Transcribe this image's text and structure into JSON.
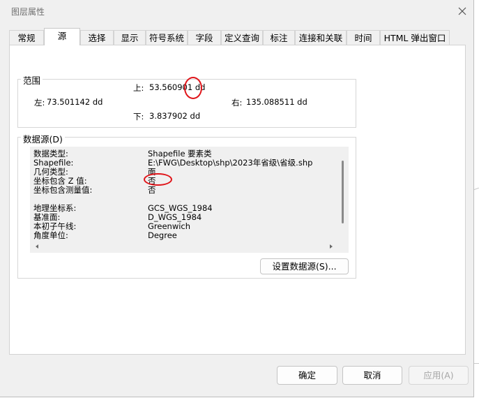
{
  "window": {
    "title": "图层属性"
  },
  "tabs": [
    {
      "label": "常规"
    },
    {
      "label": "源"
    },
    {
      "label": "选择"
    },
    {
      "label": "显示"
    },
    {
      "label": "符号系统"
    },
    {
      "label": "字段"
    },
    {
      "label": "定义查询"
    },
    {
      "label": "标注"
    },
    {
      "label": "连接和关联"
    },
    {
      "label": "时间"
    },
    {
      "label": "HTML 弹出窗口"
    }
  ],
  "active_tab": "源",
  "extent": {
    "title": "范围",
    "top_label": "上:",
    "top_value": "53.560901 dd",
    "left_label": "左:",
    "left_value": "73.501142 dd",
    "right_label": "右:",
    "right_value": "135.088511 dd",
    "bottom_label": "下:",
    "bottom_value": "3.837902 dd"
  },
  "datasource": {
    "title": "数据源(D)",
    "rows": [
      {
        "label": "数据类型:",
        "value": "Shapefile 要素类"
      },
      {
        "label": "Shapefile:",
        "value": "E:\\FWG\\Desktop\\shp\\2023年省级\\省级.shp"
      },
      {
        "label": "几何类型:",
        "value": "面"
      },
      {
        "label": "坐标包含 Z 值:",
        "value": "否"
      },
      {
        "label": "坐标包含测量值:",
        "value": "否"
      },
      {
        "label": "地理坐标系:",
        "value": "GCS_WGS_1984"
      },
      {
        "label": "基准面:",
        "value": "D_WGS_1984"
      },
      {
        "label": "本初子午线:",
        "value": "Greenwich"
      },
      {
        "label": "角度单位:",
        "value": "Degree"
      }
    ],
    "set_button": "设置数据源(S)..."
  },
  "footer": {
    "ok": "确定",
    "cancel": "取消",
    "apply": "应用(A)"
  },
  "colors": {
    "annotation": "#e0151a",
    "dialog_bg": "#f0f0f0",
    "panel_bg": "#ffffff"
  }
}
